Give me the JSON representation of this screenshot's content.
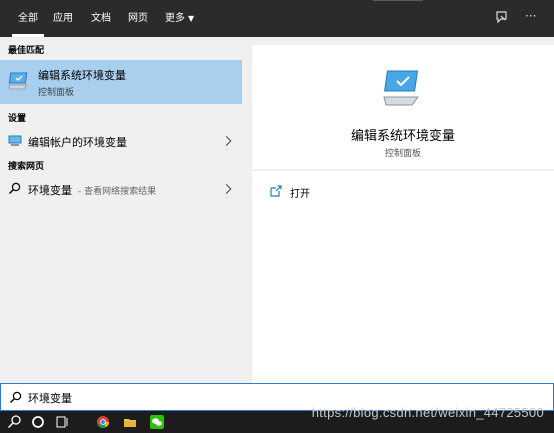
{
  "tabs": [
    {
      "label": "全部"
    },
    {
      "label": "应用"
    },
    {
      "label": "文档"
    },
    {
      "label": "网页"
    },
    {
      "label": "更多"
    }
  ],
  "top_icons": {
    "feedback": "feedback-icon",
    "more": "···"
  },
  "left": {
    "best_match_heading": "最佳匹配",
    "best_match": {
      "title": "编辑系统环境变量",
      "subtitle": "控制面板"
    },
    "settings_heading": "设置",
    "settings_item": {
      "title": "编辑帐户的环境变量"
    },
    "web_heading": "搜索网页",
    "web_item": {
      "title": "环境变量",
      "hint": "- 查看网络搜索结果"
    }
  },
  "right": {
    "title": "编辑系统环境变量",
    "subtitle": "控制面板",
    "open_label": "打开"
  },
  "search": {
    "value": "环境变量"
  },
  "watermark": "https://blog.csdn.net/weixin_44725500"
}
